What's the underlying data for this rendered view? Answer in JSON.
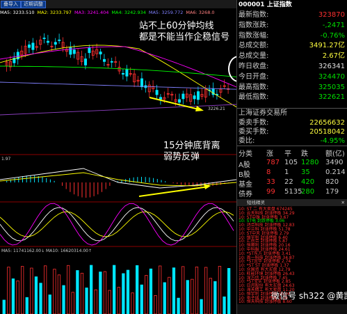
{
  "tabs": [
    "叠导入",
    "近期调整"
  ],
  "ma_top": [
    {
      "label": "MA5: 3233.510",
      "color": "#ffffff"
    },
    {
      "label": "MA2: 3233.797",
      "color": "#ffff00"
    },
    {
      "label": "MA3: 3241.404",
      "color": "#ff00ff"
    },
    {
      "label": "MA4: 3242.934",
      "color": "#00ff00"
    },
    {
      "label": "MA5: 3259.772",
      "color": "#8080ff"
    },
    {
      "label": "MA6: 3268.0",
      "color": "#ff8080"
    }
  ],
  "price_labels": {
    "low": "3226.21"
  },
  "annotations": {
    "note1_line1": "站不上60分钟均线",
    "note1_line2": "都是不能当作企稳信号",
    "note2_line1": "15分钟底背离",
    "note2_line2": "弱势反弹"
  },
  "macd_label": "1.97",
  "vol_label": "MA5: 11741162.00↓  MA10: 16620314.00↑",
  "quote": {
    "code": "000001",
    "name": "上证指数",
    "rows": [
      {
        "label": "最新指数:",
        "value": "323870",
        "color": "red"
      },
      {
        "label": "指数涨跌:",
        "value": "-,2471",
        "color": "green"
      },
      {
        "label": "指数涨幅:",
        "value": "-0.76%",
        "color": "green"
      },
      {
        "label": "总成交额:",
        "value": "3491.27亿",
        "color": "yellow"
      },
      {
        "label": "总成交量:",
        "value": "2.67亿",
        "color": "yellow"
      },
      {
        "label": "昨日收盘:",
        "value": "326341",
        "color": "white"
      },
      {
        "label": "今日开盘:",
        "value": "324470",
        "color": "green"
      },
      {
        "label": "最高指数:",
        "value": "325035",
        "color": "green"
      },
      {
        "label": "最低指数:",
        "value": "322621",
        "color": "green"
      }
    ],
    "exchange": "上海证券交易所",
    "order_rows": [
      {
        "label": "委卖手数:",
        "value": "22656632",
        "color": "yellow"
      },
      {
        "label": "委买手数:",
        "value": "20518042",
        "color": "yellow"
      },
      {
        "label": "委比:",
        "value": "-4.95%",
        "color": "green"
      }
    ]
  },
  "breadth": {
    "headers": [
      "分类",
      "涨",
      "平",
      "跌",
      "额(亿)"
    ],
    "rows": [
      {
        "name": "A股",
        "up": "787",
        "flat": "105",
        "down": "1280",
        "amt": "3490"
      },
      {
        "name": "B股",
        "up": "8",
        "flat": "1",
        "down": "35",
        "amt": "0.214"
      },
      {
        "name": "基金",
        "up": "33",
        "flat": "22",
        "down": "420",
        "amt": "820"
      },
      {
        "name": "债券",
        "up": "99",
        "flat": "5135",
        "down": "280",
        "amt": "179"
      }
    ]
  },
  "news": {
    "header": "短线精灵",
    "header_right": "✕",
    "items": [
      {
        "time": "10:",
        "text": "ST  二 有大卖盘 674245",
        "color": "red"
      },
      {
        "time": "10:",
        "text": "云天科技 封涨停板  34.29",
        "color": "red"
      },
      {
        "time": "10:",
        "text": "ST中珠 封涨停板  3.67",
        "color": "red"
      },
      {
        "time": "10:",
        "text": "ST电  封跌停板  3.06",
        "color": "green"
      },
      {
        "time": "10:",
        "text": "鸿合科技 封涨停板  12.83",
        "color": "red"
      },
      {
        "time": "10:",
        "text": "中兰科 封涨停板  51.78",
        "color": "red"
      },
      {
        "time": "10:",
        "text": "ST中天 封涨停板  2.79",
        "color": "red"
      },
      {
        "time": "10:",
        "text": "恒宇利 封涨停板  6.40",
        "color": "red"
      },
      {
        "time": "10:",
        "text": "汇创合 封涨停板  5.87",
        "color": "red"
      },
      {
        "time": "10:",
        "text": "恒顺利 封涨停板  20.16",
        "color": "red"
      },
      {
        "time": "10:",
        "text": "中科服 封涨停板  24.61",
        "color": "red"
      },
      {
        "time": "10:",
        "text": "*ST东方 封涨停板  3.41",
        "color": "red"
      },
      {
        "time": "10:",
        "text": "首一科技 封涨停板  34.87",
        "color": "red"
      },
      {
        "time": "10:",
        "text": "*ST宜华 封涨停板  2.74",
        "color": "red"
      },
      {
        "time": "10:",
        "text": "*ST ST 封涨停板  1.37",
        "color": "red"
      },
      {
        "time": "10:",
        "text": "众国资 有大买盘  12.79",
        "color": "red"
      },
      {
        "time": "10:",
        "text": "旺能环境 封涨停板  26.43",
        "color": "red"
      },
      {
        "time": "10:",
        "text": "深方信 封涨停板  7.45",
        "color": "red"
      },
      {
        "time": "10:",
        "text": "*ST宝实 封涨停板  2.85",
        "color": "red"
      },
      {
        "time": "10:",
        "text": "日月股份 有大买盘  24.63",
        "color": "red"
      },
      {
        "time": "10:",
        "text": "海天精工 有大卖盘  11.20",
        "color": "red"
      },
      {
        "time": "10:",
        "text": "恒宇利 封涨停板  30.06",
        "color": "red"
      },
      {
        "time": "10:",
        "text": "电子城 封涨停板  3.09",
        "color": "red"
      },
      {
        "time": "10:",
        "text": "恒天科技 封涨停板  8.60",
        "color": "red"
      }
    ]
  },
  "watermark": "微信号 sh322 @黄凯杰",
  "colors": {
    "up": "#ff3030",
    "down": "#00ffff",
    "accent": "#ffff00"
  }
}
